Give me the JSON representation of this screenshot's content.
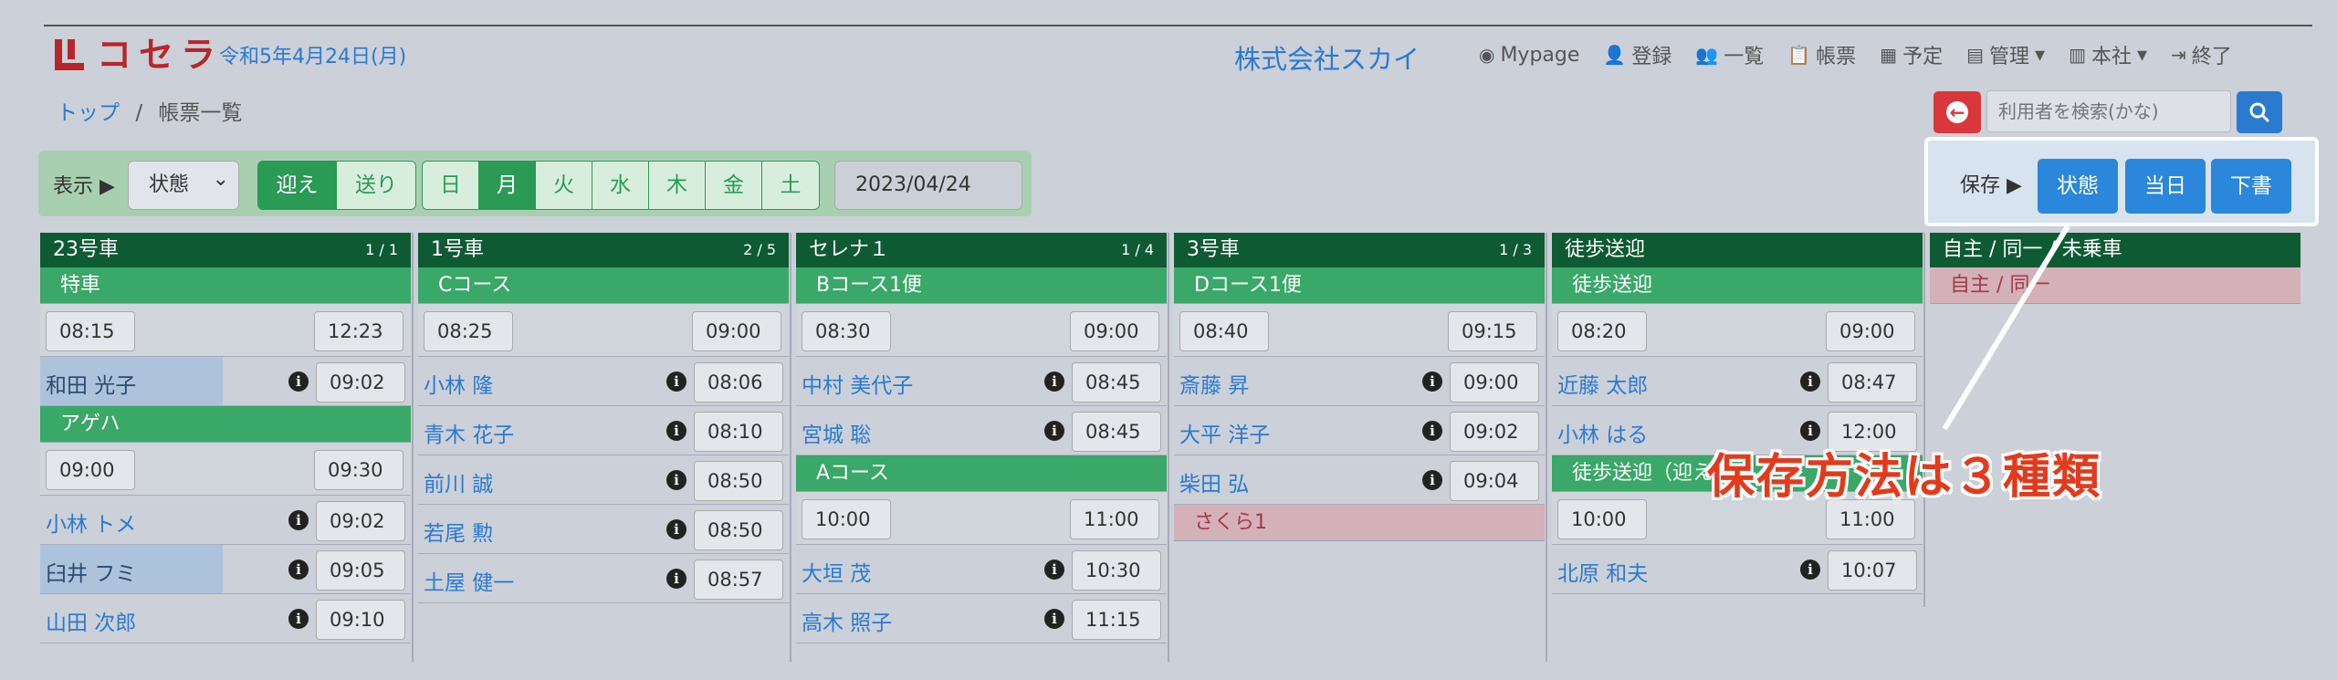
{
  "header": {
    "logo_text": "コセラ",
    "date": "令和5年4月24日(月)",
    "company": "株式会社スカイ",
    "nav": [
      {
        "icon": "user-circle-icon",
        "label": "Mypage"
      },
      {
        "icon": "user-plus-icon",
        "label": "登録"
      },
      {
        "icon": "users-icon",
        "label": "一覧"
      },
      {
        "icon": "clipboard-icon",
        "label": "帳票"
      },
      {
        "icon": "calendar-icon",
        "label": "予定"
      },
      {
        "icon": "grid-icon",
        "label": "管理",
        "dropdown": true
      },
      {
        "icon": "building-icon",
        "label": "本社",
        "dropdown": true
      },
      {
        "icon": "logout-icon",
        "label": "終了"
      }
    ]
  },
  "breadcrumb": {
    "home": "トップ",
    "sep": "/",
    "current": "帳票一覧"
  },
  "search": {
    "placeholder": "利用者を検索(かな)"
  },
  "toolbar": {
    "show_label": "表示 ▶",
    "select_value": "状態",
    "direction": [
      "迎え",
      "送り"
    ],
    "days": [
      "日",
      "月",
      "火",
      "水",
      "木",
      "金",
      "土"
    ],
    "date_value": "2023/04/24"
  },
  "save": {
    "label": "保存 ▶",
    "buttons": [
      "状態",
      "当日",
      "下書"
    ]
  },
  "annotation": "保存方法は３種類",
  "columns": [
    {
      "title": "23号車",
      "count": "1 / 1",
      "groups": [
        {
          "course": "特車",
          "start": "08:15",
          "end": "12:23",
          "people": [
            {
              "name": "和田 光子",
              "time": "09:02",
              "hl": true
            }
          ]
        },
        {
          "course": "アゲハ",
          "start": "09:00",
          "end": "09:30",
          "people": [
            {
              "name": "小林 トメ",
              "time": "09:02"
            },
            {
              "name": "臼井 フミ",
              "time": "09:05",
              "hl": true
            },
            {
              "name": "山田 次郎",
              "time": "09:10"
            }
          ]
        }
      ]
    },
    {
      "title": "1号車",
      "count": "2 / 5",
      "groups": [
        {
          "course": "Cコース",
          "start": "08:25",
          "end": "09:00",
          "people": [
            {
              "name": "小林 隆",
              "time": "08:06"
            },
            {
              "name": "青木 花子",
              "time": "08:10"
            },
            {
              "name": "前川 誠",
              "time": "08:50"
            },
            {
              "name": "若尾 勲",
              "time": "08:50"
            },
            {
              "name": "土屋 健一",
              "time": "08:57"
            }
          ]
        }
      ]
    },
    {
      "title": "セレナ１",
      "count": "1 / 4",
      "groups": [
        {
          "course": "Bコース1便",
          "start": "08:30",
          "end": "09:00",
          "people": [
            {
              "name": "中村 美代子",
              "time": "08:45"
            },
            {
              "name": "宮城 聡",
              "time": "08:45"
            }
          ]
        },
        {
          "course": "Aコース",
          "start": "10:00",
          "end": "11:00",
          "people": [
            {
              "name": "大垣 茂",
              "time": "10:30"
            },
            {
              "name": "高木 照子",
              "time": "11:15"
            }
          ]
        }
      ]
    },
    {
      "title": "3号車",
      "count": "1 / 3",
      "groups": [
        {
          "course": "Dコース1便",
          "start": "08:40",
          "end": "09:15",
          "people": [
            {
              "name": "斎藤 昇",
              "time": "09:00"
            },
            {
              "name": "大平 洋子",
              "time": "09:02"
            },
            {
              "name": "柴田 弘",
              "time": "09:04"
            }
          ]
        },
        {
          "course": "さくら1",
          "pink": true,
          "people": []
        }
      ]
    },
    {
      "title": "徒歩送迎",
      "count": "",
      "groups": [
        {
          "course": "徒歩送迎",
          "start": "08:20",
          "end": "09:00",
          "people": [
            {
              "name": "近藤 太郎",
              "time": "08:47"
            },
            {
              "name": "小林 はる",
              "time": "12:00"
            }
          ]
        },
        {
          "course": "徒歩送迎（迎え）",
          "start": "10:00",
          "end": "11:00",
          "people": [
            {
              "name": "北原 和夫",
              "time": "10:07"
            }
          ]
        }
      ]
    },
    {
      "title": "自主 / 同一 / 未乗車",
      "count": "",
      "groups": [
        {
          "course": "自主 / 同一",
          "pink": true,
          "people": []
        }
      ]
    }
  ]
}
